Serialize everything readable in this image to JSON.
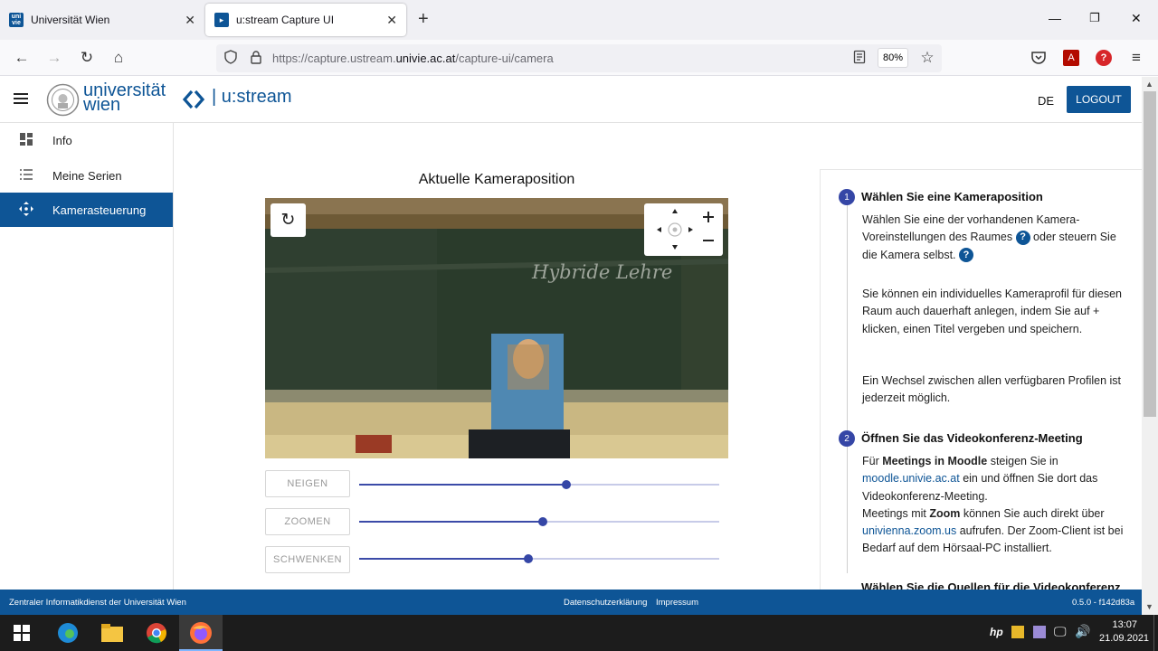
{
  "browser": {
    "tabs": [
      {
        "label": "Universität Wien",
        "favicon": "univie-favicon"
      },
      {
        "label": "u:stream Capture UI",
        "favicon": "ustream-favicon"
      }
    ],
    "url_prefix": "https://capture.ustream.",
    "url_domain": "univie.ac.at",
    "url_path": "/capture-ui/camera",
    "zoom": "80%"
  },
  "header": {
    "logo_line1": "universität",
    "logo_line2": "wien",
    "app_name": "u:stream",
    "lang": "DE",
    "logout": "LOGOUT"
  },
  "sidebar": {
    "items": [
      {
        "label": "Info",
        "icon": "dashboard-icon",
        "active": false
      },
      {
        "label": "Meine Serien",
        "icon": "list-icon",
        "active": false
      },
      {
        "label": "Kamerasteuerung",
        "icon": "move-arrows-icon",
        "active": true
      }
    ]
  },
  "camera": {
    "title": "Aktuelle Kameraposition",
    "board_text": "Hybride Lehre",
    "sliders": [
      {
        "label": "NEIGEN",
        "value": 0.575
      },
      {
        "label": "ZOOMEN",
        "value": 0.51
      },
      {
        "label": "SCHWENKEN",
        "value": 0.47
      }
    ]
  },
  "instructions": {
    "step1": {
      "num": "1",
      "title": "Wählen Sie eine Kameraposition",
      "p1a": "Wählen Sie eine der vorhandenen Kamera-Voreinstellungen des Raumes",
      "p1b": "oder steuern Sie die Kamera selbst.",
      "p2": "Sie können ein individuelles Kameraprofil für diesen Raum auch dauerhaft anlegen, indem Sie auf + klicken, einen Titel vergeben und speichern.",
      "p3": "Ein Wechsel zwischen allen verfügbaren Profilen ist jederzeit möglich."
    },
    "step2": {
      "num": "2",
      "title": "Öffnen Sie das Videokonferenz-Meeting",
      "l1a": "Für",
      "l1b": "Meetings in Moodle",
      "l1c": "steigen Sie in",
      "link1": "moodle.univie.ac.at",
      "l1d": "ein und öffnen Sie dort das Videokonferenz-Meeting.",
      "l2a": "Meetings mit",
      "l2b": "Zoom",
      "l2c": "können Sie auch direkt über",
      "link2": "univienna.zoom.us",
      "l2d": "aufrufen. Der Zoom-Client ist bei Bedarf auf dem Hörsaal-PC installiert."
    },
    "step3": {
      "title": "Wählen Sie die Quellen für die Videokonferenz"
    }
  },
  "footer": {
    "left": "Zentraler Informatikdienst der Universität Wien",
    "privacy": "Datenschutzerklärung",
    "imprint": "Impressum",
    "version": "0.5.0 - f142d83a"
  },
  "taskbar": {
    "time": "13:07",
    "date": "21.09.2021"
  }
}
